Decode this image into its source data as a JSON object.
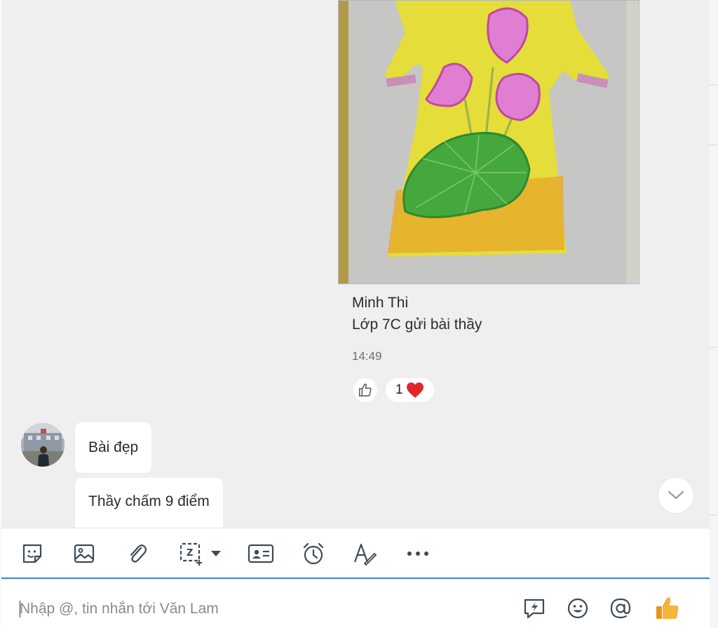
{
  "message": {
    "sender_name": "Minh Thi",
    "caption": "Lớp 7C gửi bài thầy",
    "time": "14:49",
    "reaction_count": "1",
    "image_description_icon": "photo-of-drawing"
  },
  "incoming": [
    {
      "text": "Bài đẹp"
    },
    {
      "text": "Thầy chấm 9 điểm"
    }
  ],
  "toolbar": {
    "items": [
      "sticker-icon",
      "image-icon",
      "attachment-icon",
      "screenshot-icon",
      "business-card-icon",
      "reminder-icon",
      "text-format-icon",
      "more-icon"
    ]
  },
  "input": {
    "placeholder": "Nhập @, tin nhắn tới Văn Lam",
    "value": ""
  },
  "colors": {
    "chat_background": "#efefef",
    "accent": "#3a86d4",
    "icon": "#3d4a57",
    "like_thumb": "#f5a623",
    "heart": "#e0262b"
  }
}
